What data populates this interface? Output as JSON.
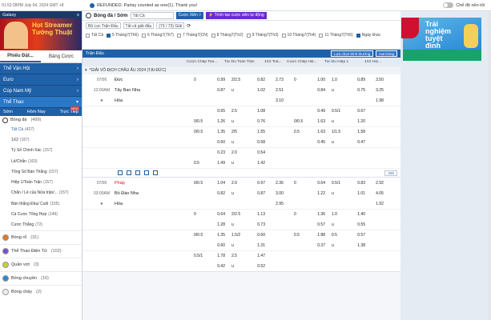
{
  "topbar": {
    "time": "01:52:28PM July 04, 2024 GMT +8",
    "announcement": "REFUNDED. Parlay counted as one(1). Thank you!",
    "dark_mode": "Chế độ nền tối"
  },
  "left": {
    "brand": "Galaxy",
    "banner": {
      "line1": "Hot Streamer",
      "line2": "Tướng Thuật"
    },
    "tabs": [
      "Phiếu Đặt...",
      "Bảng Cược"
    ],
    "cats": [
      {
        "label": "Thể Vận Hội",
        "sel": false
      },
      {
        "label": "Euro",
        "sel": false
      },
      {
        "label": "Cúp Nam Mỹ",
        "sel": false
      },
      {
        "label": "Thể Thao",
        "sel": true
      }
    ],
    "subtabs": [
      "Sớm",
      "Hôm Nay",
      "Trực Tiếp"
    ],
    "live_badge": "NEW",
    "soccer": {
      "label": "Bóng đá",
      "count": "(499)"
    },
    "subs": [
      {
        "label": "Tất Cả",
        "count": "(427)",
        "active": true
      },
      {
        "label": "1X2",
        "count": "(167)"
      },
      {
        "label": "Tỷ Số Chính Xác",
        "count": "(157)"
      },
      {
        "label": "Lẻ/Chẵn",
        "count": "(163)"
      },
      {
        "label": "Tổng Số Bàn Thắng",
        "count": "(157)"
      },
      {
        "label": "Hiệp 1/Toàn Trận",
        "count": "(157)"
      },
      {
        "label": "Chẵn / Lẻ của Nửa trận/...",
        "count": "(157)"
      },
      {
        "label": "Bàn thắng Đầu/ Cuối",
        "count": "(155)"
      },
      {
        "label": "Cá Cược Tổng Hợp",
        "count": "(149)"
      },
      {
        "label": "Cược Thắng",
        "count": "(72)"
      }
    ],
    "sports": [
      {
        "label": "Bóng rổ",
        "count": "(31)",
        "color": "#e8761c"
      },
      {
        "label": "Thể Thao Điện Tử",
        "count": "(102)",
        "color": "#7a4fd0"
      },
      {
        "label": "Quần vợt",
        "count": "(3)",
        "color": "#c8d12a"
      },
      {
        "label": "Bóng chuyền",
        "count": "(16)",
        "color": "#2a88d8"
      },
      {
        "label": "Bóng chày",
        "count": "(2)",
        "color": "#eee"
      }
    ]
  },
  "main": {
    "title": "Bóng đá / Sớm",
    "filter_all": "Tất Cả",
    "btn_bet": "Cược Xiên",
    "btn_bet_icon": ">",
    "btn_promo": "⚡ Trình tạo cược xiên tự động",
    "sel_filter": "Bộ Lọc Trận Đấu",
    "sel_league": "Tất cả giải đấu",
    "sel_count": "(73 / 73) Giải",
    "dates": [
      {
        "label": "Tất Cả",
        "on": false
      },
      {
        "label": "5 Tháng7(Th6)",
        "on": true
      },
      {
        "label": "6 Tháng7(Th7)",
        "on": false
      },
      {
        "label": "7 Tháng7(CN)",
        "on": false
      },
      {
        "label": "8 Tháng7(Th2)",
        "on": false
      },
      {
        "label": "9 Tháng7(Th3)",
        "on": false
      },
      {
        "label": "10 Tháng7(Th4)",
        "on": false
      },
      {
        "label": "11 Tháng7(Th5)",
        "on": false
      },
      {
        "label": "Ngày khác",
        "on": true
      }
    ],
    "bar_label": "Trận Đấu",
    "bar_sort": "Lựa chọn bình thường",
    "bar_odds": "Hai Dòng",
    "cols": [
      "Cược Chấp Toà...",
      "Tài Xỉu Toàn Trận",
      "1X2 Toà...",
      "Cược Chấp Hiệ...",
      "Tài Xỉu Hiệp 1",
      "1X2 Hiệ..."
    ],
    "league": "*GIẢI VÔ ĐỊCH CHÂU ÂU 2024 (TẠI ĐỨC)",
    "matches": [
      {
        "date": "07/06",
        "time": "12:00AM",
        "home": "Đức",
        "away": "Tây Ban Nha",
        "draw": "Hòa",
        "red": false,
        "rows": [
          [
            "0",
            "0.99",
            "2/2.5",
            "0.82",
            "2.73",
            "0",
            "1.00",
            "1.0",
            "0.89",
            "3.50"
          ],
          [
            "",
            "0.87",
            "u",
            "1.02",
            "2.51",
            "",
            "0.84",
            "u",
            "0.75",
            "3.25"
          ],
          [
            "",
            "",
            "",
            "",
            "3.10",
            "",
            "",
            "",
            "",
            "1.98"
          ],
          [
            "",
            "0.65",
            "2.5",
            "1.08",
            "",
            "",
            "0.49",
            "0.5/1",
            "0.67",
            ""
          ],
          [
            "0/0.5",
            "1.26",
            "u",
            "0.76",
            "",
            "0/0.5",
            "1.63",
            "u",
            "1.20",
            ""
          ],
          [
            "0/0.5",
            "1.35",
            "2/5",
            "1.55",
            "",
            "0.5",
            "1.63",
            "1/1.5",
            "1.58",
            ""
          ],
          [
            "",
            "0.60",
            "u",
            "0.58",
            "",
            "",
            "0.45",
            "u",
            "0.47",
            ""
          ],
          [
            "",
            "0.23",
            "2.0",
            "0.54",
            "",
            "",
            "",
            "",
            "",
            ""
          ],
          [
            "0.5",
            "1.49",
            "u",
            "1.42",
            "",
            "",
            "",
            "",
            "",
            ""
          ]
        ],
        "more": "220"
      },
      {
        "date": "07/06",
        "time": "03:00AM",
        "home": "Pháp",
        "away": "Bồ Đào Nha",
        "draw": "Hòa",
        "red": true,
        "rows": [
          [
            "0/0.5",
            "1.04",
            "2.0",
            "0.97",
            "2.36",
            "0",
            "0.64",
            "0.5/1",
            "0.83",
            "2.92"
          ],
          [
            "",
            "0.82",
            "u",
            "0.87",
            "3.00",
            "",
            "1.22",
            "u",
            "1.01",
            "4.05"
          ],
          [
            "",
            "",
            "",
            "",
            "2.95",
            "",
            "",
            "",
            "",
            "1.92"
          ],
          [
            "0",
            "0.64",
            "2/2.5",
            "1.13",
            "",
            "0",
            "1.36",
            "1.0",
            "1.40",
            ""
          ],
          [
            "",
            "1.28",
            "u",
            "0.73",
            "",
            "",
            "0.57",
            "u",
            "0.55",
            ""
          ],
          [
            "0/0.5",
            "1.35",
            "1.5/2",
            "0.60",
            "",
            "0.5",
            "1.88",
            "0.5",
            "0.57",
            ""
          ],
          [
            "",
            "0.60",
            "u",
            "1.31",
            "",
            "",
            "0.37",
            "u",
            "1.38",
            ""
          ],
          [
            "0.5/1",
            "1.78",
            "2.5",
            "1.47",
            "",
            "",
            "",
            "",
            "",
            ""
          ],
          [
            "",
            "0.42",
            "u",
            "0.52",
            "",
            "",
            "",
            "",
            "",
            ""
          ]
        ]
      }
    ]
  },
  "right": {
    "banner_line1": "Trải nghiệm",
    "banner_line2": "tuyệt đỉnh"
  }
}
